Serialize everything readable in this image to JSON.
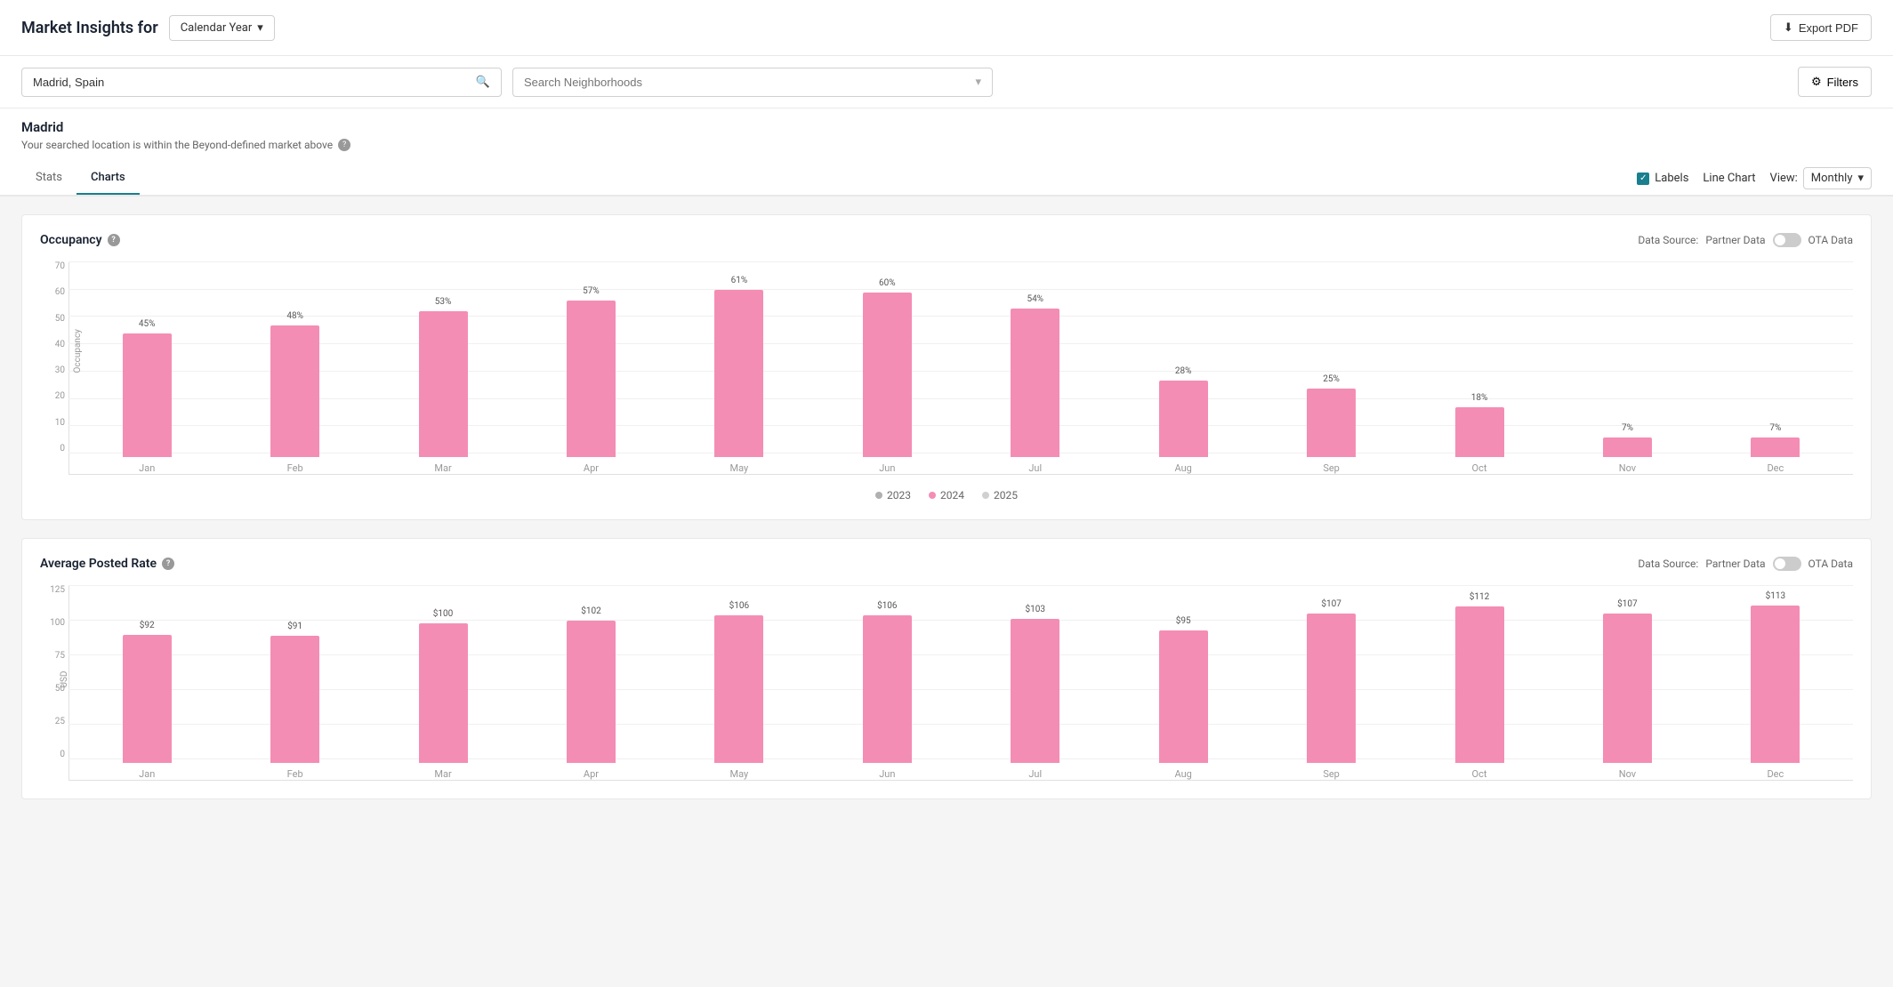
{
  "header": {
    "title": "Market Insights for",
    "calendar_label": "Calendar Year",
    "export_label": "Export PDF"
  },
  "search": {
    "location_value": "Madrid, Spain",
    "location_placeholder": "Madrid, Spain",
    "neighborhoods_placeholder": "Search Neighborhoods"
  },
  "filters": {
    "button_label": "Filters"
  },
  "location": {
    "name": "Madrid",
    "subtitle": "Your searched location is within the Beyond-defined market above"
  },
  "tabs": [
    {
      "id": "stats",
      "label": "Stats"
    },
    {
      "id": "charts",
      "label": "Charts"
    }
  ],
  "controls": {
    "labels_label": "Labels",
    "line_chart_label": "Line Chart",
    "view_label": "View:",
    "view_value": "Monthly"
  },
  "occupancy_chart": {
    "title": "Occupancy",
    "data_source_label": "Data Source:",
    "partner_data_label": "Partner Data",
    "ota_data_label": "OTA Data",
    "y_axis_label": "Occupancy",
    "y_ticks": [
      "70",
      "60",
      "50",
      "40",
      "30",
      "20",
      "10",
      "0"
    ],
    "bars": [
      {
        "month": "Jan",
        "value": 45,
        "label": "45%"
      },
      {
        "month": "Feb",
        "value": 48,
        "label": "48%"
      },
      {
        "month": "Mar",
        "value": 53,
        "label": "53%"
      },
      {
        "month": "Apr",
        "value": 57,
        "label": "57%"
      },
      {
        "month": "May",
        "value": 61,
        "label": "61%"
      },
      {
        "month": "Jun",
        "value": 60,
        "label": "60%"
      },
      {
        "month": "Jul",
        "value": 54,
        "label": "54%"
      },
      {
        "month": "Aug",
        "value": 28,
        "label": "28%"
      },
      {
        "month": "Sep",
        "value": 25,
        "label": "25%"
      },
      {
        "month": "Oct",
        "value": 18,
        "label": "18%"
      },
      {
        "month": "Nov",
        "value": 7,
        "label": "7%"
      },
      {
        "month": "Dec",
        "value": 7,
        "label": "7%"
      }
    ],
    "legend": [
      {
        "year": "2023",
        "color": "#b0b0b0"
      },
      {
        "year": "2024",
        "color": "#f48db4"
      },
      {
        "year": "2025",
        "color": "#d0d0d0"
      }
    ]
  },
  "avg_rate_chart": {
    "title": "Average Posted Rate",
    "data_source_label": "Data Source:",
    "partner_data_label": "Partner Data",
    "ota_data_label": "OTA Data",
    "y_axis_label": "USD",
    "y_ticks": [
      "125",
      "100",
      "75",
      "50",
      "25",
      "0"
    ],
    "bars": [
      {
        "month": "Jan",
        "value": 92,
        "label": "$92"
      },
      {
        "month": "Feb",
        "value": 91,
        "label": "$91"
      },
      {
        "month": "Mar",
        "value": 100,
        "label": "$100"
      },
      {
        "month": "Apr",
        "value": 102,
        "label": "$102"
      },
      {
        "month": "May",
        "value": 106,
        "label": "$106"
      },
      {
        "month": "Jun",
        "value": 106,
        "label": "$106"
      },
      {
        "month": "Jul",
        "value": 103,
        "label": "$103"
      },
      {
        "month": "Aug",
        "value": 95,
        "label": "$95"
      },
      {
        "month": "Sep",
        "value": 107,
        "label": "$107"
      },
      {
        "month": "Oct",
        "value": 112,
        "label": "$112"
      },
      {
        "month": "Nov",
        "value": 107,
        "label": "$107"
      },
      {
        "month": "Dec",
        "value": 113,
        "label": "$113"
      }
    ]
  }
}
